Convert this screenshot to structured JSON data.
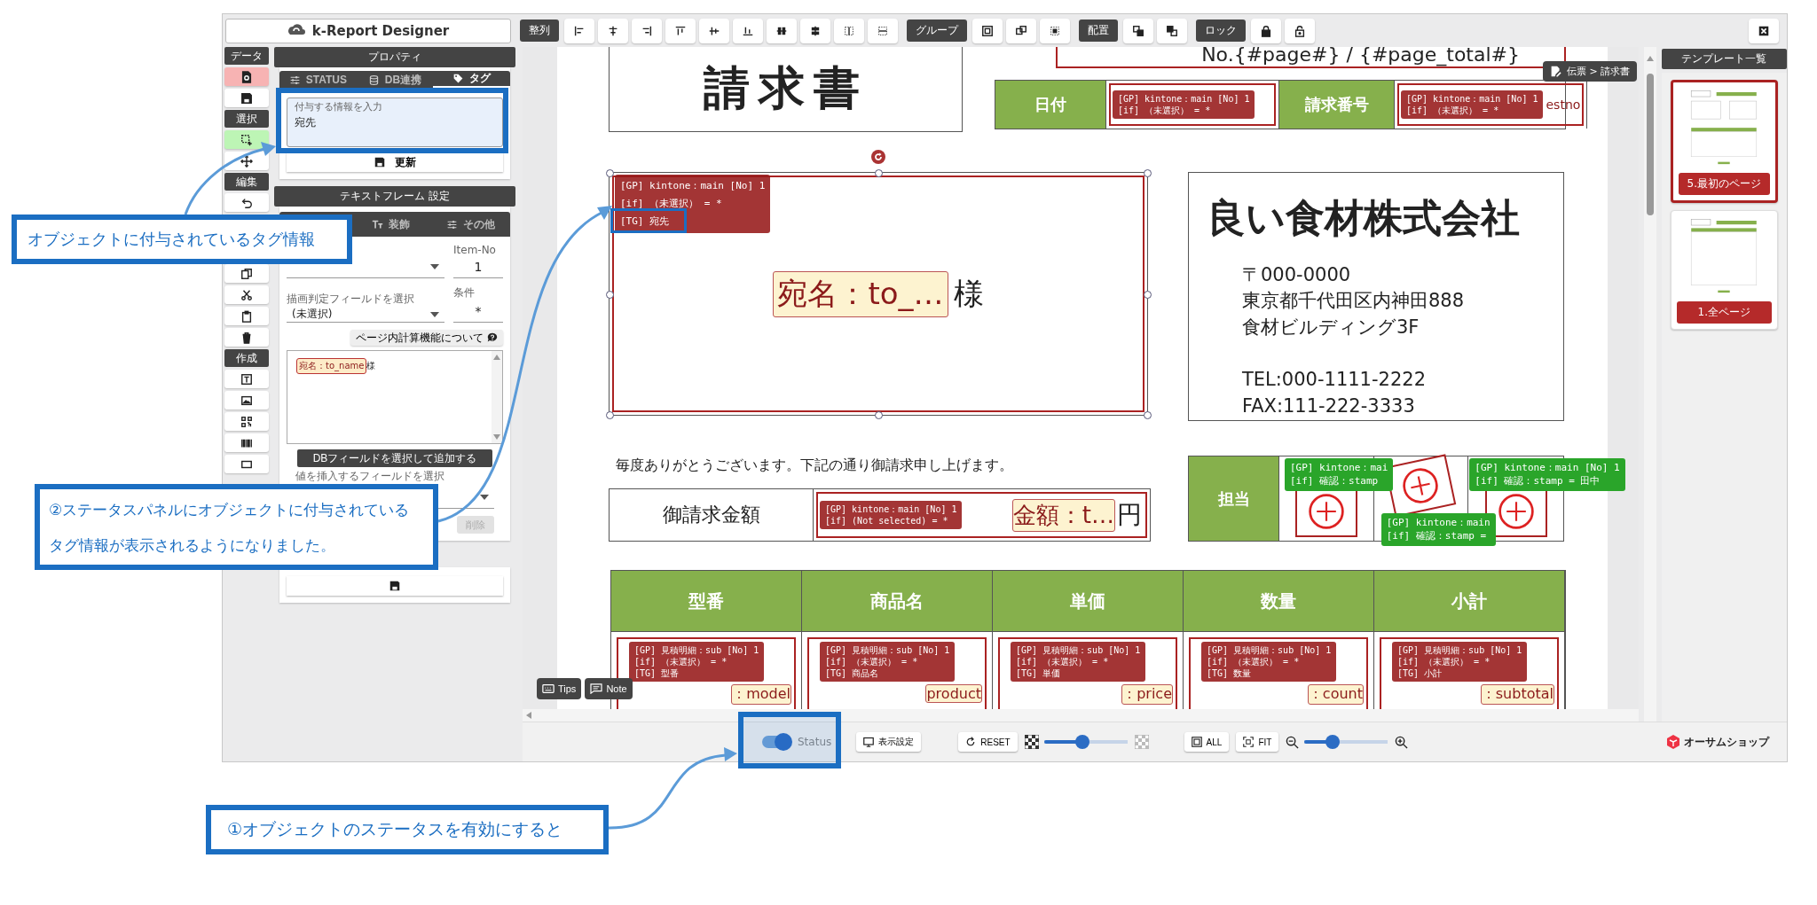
{
  "app": {
    "title": "k-Report Designer"
  },
  "toolbar_groups": [
    {
      "label": "整列"
    },
    {
      "label": "グループ"
    },
    {
      "label": "配置"
    },
    {
      "label": "ロック"
    }
  ],
  "sidebar": {
    "sections": [
      {
        "label": "データ",
        "tools": [
          {
            "kind": "preview",
            "color": "#f7b3b3"
          },
          {
            "kind": "save"
          }
        ]
      },
      {
        "label": "選択",
        "tools": [
          {
            "kind": "select-add",
            "color": "#bdf5b5"
          },
          {
            "kind": "move"
          }
        ]
      },
      {
        "label": "編集",
        "tools": [
          {
            "kind": "undo"
          },
          {
            "kind": "copy"
          },
          {
            "kind": "cut"
          },
          {
            "kind": "paste"
          },
          {
            "kind": "trash"
          }
        ]
      },
      {
        "label": "作成",
        "tools": [
          {
            "kind": "text"
          },
          {
            "kind": "image"
          },
          {
            "kind": "qr"
          },
          {
            "kind": "barcode"
          },
          {
            "kind": "rect"
          }
        ]
      }
    ]
  },
  "properties": {
    "title": "プロパティ",
    "tabs": [
      {
        "label": "STATUS",
        "selected": false
      },
      {
        "label": "DB連携",
        "selected": false
      },
      {
        "label": "タグ",
        "selected": true
      }
    ],
    "tag_input": {
      "label": "付与する情報を入力",
      "value": "宛先"
    },
    "update_button": "更新"
  },
  "text_frame": {
    "title": "テキストフレーム 設定",
    "tabs": [
      {
        "label": "装飾",
        "selected": false
      },
      {
        "label": "その他",
        "selected": false
      }
    ],
    "item_no": {
      "label": "Item-No",
      "value": "1"
    },
    "condition_field": {
      "label": "描画判定フィールドを選択",
      "value": "(未選択)"
    },
    "condition": {
      "label": "条件",
      "value": "*"
    },
    "help_button": "ページ内計算機能について",
    "content": {
      "chip": "宛名：to_name",
      "text": "様"
    },
    "add_field_button": "DBフィールドを選択して追加する",
    "insert_field": {
      "label": "値を挿入するフィールドを選択"
    },
    "delete_button": {
      "label": "削除",
      "disabled": true
    }
  },
  "canvas": {
    "breadcrumb": "伝票 > 請求書",
    "tips": "Tips",
    "note": "Note"
  },
  "document": {
    "title": "請求書",
    "page_no": "No.{#page#} / {#page_total#}",
    "header_fields": [
      {
        "label": "日付",
        "status": [
          "[GP] kintone：main [No] 1",
          "[if] （未選択） = *"
        ]
      },
      {
        "label": "請求番号",
        "field": "estno",
        "status": [
          "[GP] kintone：main [No] 1",
          "[if] （未選択） = *"
        ]
      }
    ],
    "recipient": {
      "selected": true,
      "field": "宛名：to_…",
      "suffix": "様",
      "status": [
        "[GP] kintone：main [No] 1",
        "[if] （未選択） = *",
        "[TG] 宛先"
      ]
    },
    "company": {
      "name": "良い食材株式会社",
      "address": [
        "〒000-0000",
        "東京都千代田区内神田888",
        "食材ビルディング3F"
      ],
      "contact": [
        "TEL:000-1111-2222",
        "FAX:111-222-3333"
      ]
    },
    "greeting": "毎度ありがとうございます。下記の通り御請求申し上げます。",
    "amount": {
      "label": "御請求金額",
      "field": "金額：t…",
      "suffix": "円",
      "status": [
        "[GP] kintone：main [No] 1",
        "[if] (Not selected) = *"
      ]
    },
    "approval": {
      "label": "担当",
      "stamps": [
        {
          "status": [
            "[GP] kintone：mai",
            "[if] 確認：stamp"
          ]
        },
        {
          "status": [
            "[GP] kintone：main",
            "[if] 確認：stamp ="
          ]
        },
        {
          "status": [
            "[GP] kintone：main [No] 1",
            "[if] 確認：stamp = 田中"
          ]
        }
      ]
    },
    "table": {
      "columns": [
        "型番",
        "商品名",
        "単価",
        "数量",
        "小計"
      ],
      "cells": [
        {
          "field": "：model",
          "status": [
            "[GP] 見積明細：sub [No] 1",
            "[if] （未選択） = *",
            "[TG] 型番"
          ]
        },
        {
          "field": "product",
          "status": [
            "[GP] 見積明細：sub [No] 1",
            "[if] （未選択） = *",
            "[TG] 商品名"
          ]
        },
        {
          "field": "：price",
          "status": [
            "[GP] 見積明細：sub [No] 1",
            "[if] （未選択） = *",
            "[TG] 単価"
          ]
        },
        {
          "field": "：count",
          "status": [
            "[GP] 見積明細：sub [No] 1",
            "[if] （未選択） = *",
            "[TG] 数量"
          ]
        },
        {
          "field": "：subtotal",
          "status": [
            "[GP] 見積明細：sub [No] 1",
            "[if] （未選択） = *",
            "[TG] 小計"
          ]
        }
      ]
    }
  },
  "templates": {
    "title": "テンプレート一覧",
    "items": [
      {
        "label": "5.最初のページ",
        "selected": true
      },
      {
        "label": "1.全ページ",
        "selected": false
      }
    ]
  },
  "bottom_bar": {
    "status_toggle": {
      "label": "Status",
      "on": true
    },
    "display_settings": "表示設定",
    "reset": "RESET",
    "contrast_slider": {
      "level": 0.45
    },
    "all": "ALL",
    "fit": "FIT",
    "zoom_slider": {
      "level": 0.3
    },
    "brand": "オーサムショップ"
  },
  "annotations": [
    {
      "text": "オブジェクトに付与されているタグ情報"
    },
    {
      "text": "②ステータスパネルにオブジェクトに付与されているタグ情報が表示されるようになりました。"
    },
    {
      "text": "①オブジェクトのステータスを有効にすると"
    }
  ]
}
